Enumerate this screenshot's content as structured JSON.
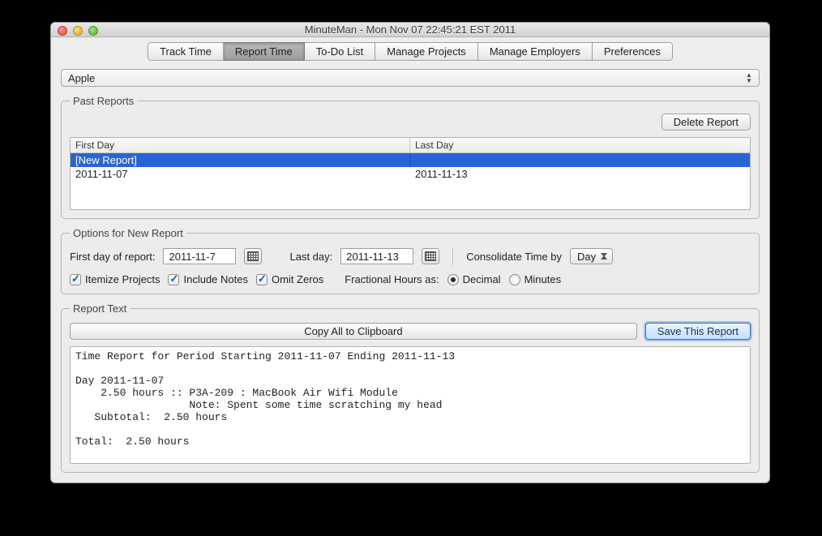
{
  "window": {
    "title": "MinuteMan - Mon Nov 07 22:45:21 EST 2011"
  },
  "tabs": {
    "track": "Track Time",
    "report": "Report Time",
    "todo": "To-Do List",
    "projects": "Manage Projects",
    "employers": "Manage Employers",
    "prefs": "Preferences",
    "active": "report"
  },
  "employer_select": {
    "value": "Apple"
  },
  "past_reports": {
    "legend": "Past Reports",
    "delete_btn": "Delete Report",
    "columns": {
      "first": "First Day",
      "last": "Last Day"
    },
    "rows": [
      {
        "first": "[New Report]",
        "last": "",
        "selected": true
      },
      {
        "first": "2011-11-07",
        "last": "2011-11-13",
        "selected": false
      }
    ]
  },
  "options": {
    "legend": "Options for New Report",
    "first_day_label": "First day of report:",
    "first_day_value": "2011-11-7",
    "last_day_label": "Last day:",
    "last_day_value": "2011-11-13",
    "consolidate_label": "Consolidate Time by",
    "consolidate_value": "Day",
    "itemize": "Itemize Projects",
    "include_notes": "Include Notes",
    "omit_zeros": "Omit Zeros",
    "fractional_label": "Fractional Hours as:",
    "decimal": "Decimal",
    "minutes": "Minutes"
  },
  "report": {
    "legend": "Report Text",
    "copy_btn": "Copy All to Clipboard",
    "save_btn": "Save This Report",
    "text": "Time Report for Period Starting 2011-11-07 Ending 2011-11-13\n\nDay 2011-11-07\n    2.50 hours :: P3A-209 : MacBook Air Wifi Module\n                  Note: Spent some time scratching my head\n   Subtotal:  2.50 hours\n\nTotal:  2.50 hours"
  }
}
